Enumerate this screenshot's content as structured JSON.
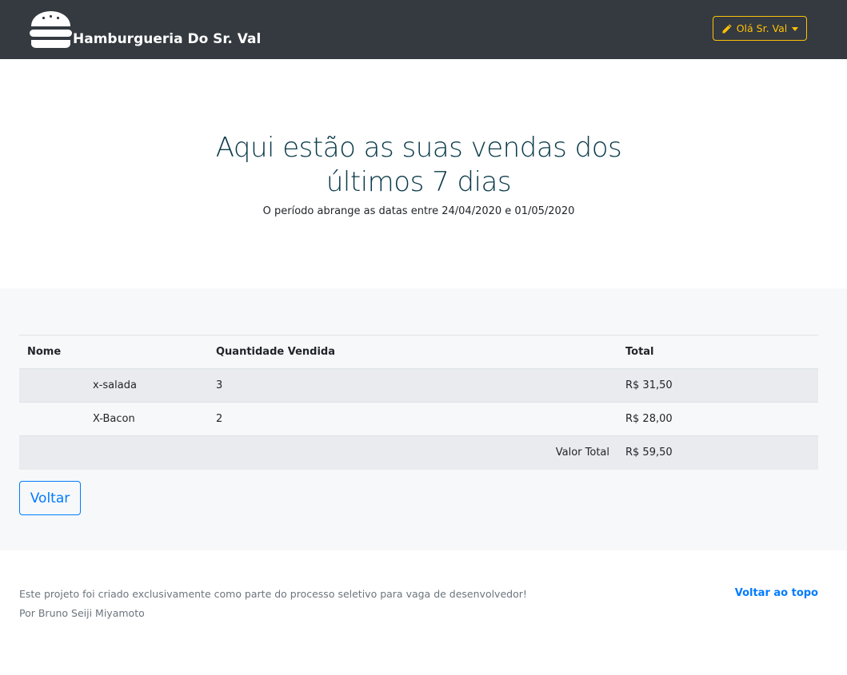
{
  "navbar": {
    "brand": "Hamburgueria Do Sr. Val",
    "logo_icon": "burger-icon",
    "user_button": "Olá Sr. Val",
    "user_icon": "pen-icon",
    "bg_color": "#343a40",
    "accent_color": "#ffc107"
  },
  "hero": {
    "title_line1": "Aqui estão as suas vendas dos",
    "title_line2": "últimos 7 dias",
    "subtitle": "O período abrange as datas entre 24/04/2020 e 01/05/2020"
  },
  "table": {
    "headers": [
      "Nome",
      "Quantidade Vendida",
      "Total"
    ],
    "rows": [
      {
        "name": "x-salada",
        "qty": "3",
        "total": "R$ 31,50"
      },
      {
        "name": "X-Bacon",
        "qty": "2",
        "total": "R$ 28,00"
      }
    ],
    "total_label": "Valor Total",
    "total_value": "R$ 59,50"
  },
  "back_button": "Voltar",
  "footer": {
    "line1": "Este projeto foi criado exclusivamente como parte do processo seletivo para vaga de desenvolvedor!",
    "line2": "Por Bruno Seiji Miyamoto",
    "top_link": "Voltar ao topo"
  },
  "colors": {
    "primary": "#007bff",
    "content_bg": "#f7f8fa",
    "muted": "#6c757d"
  }
}
